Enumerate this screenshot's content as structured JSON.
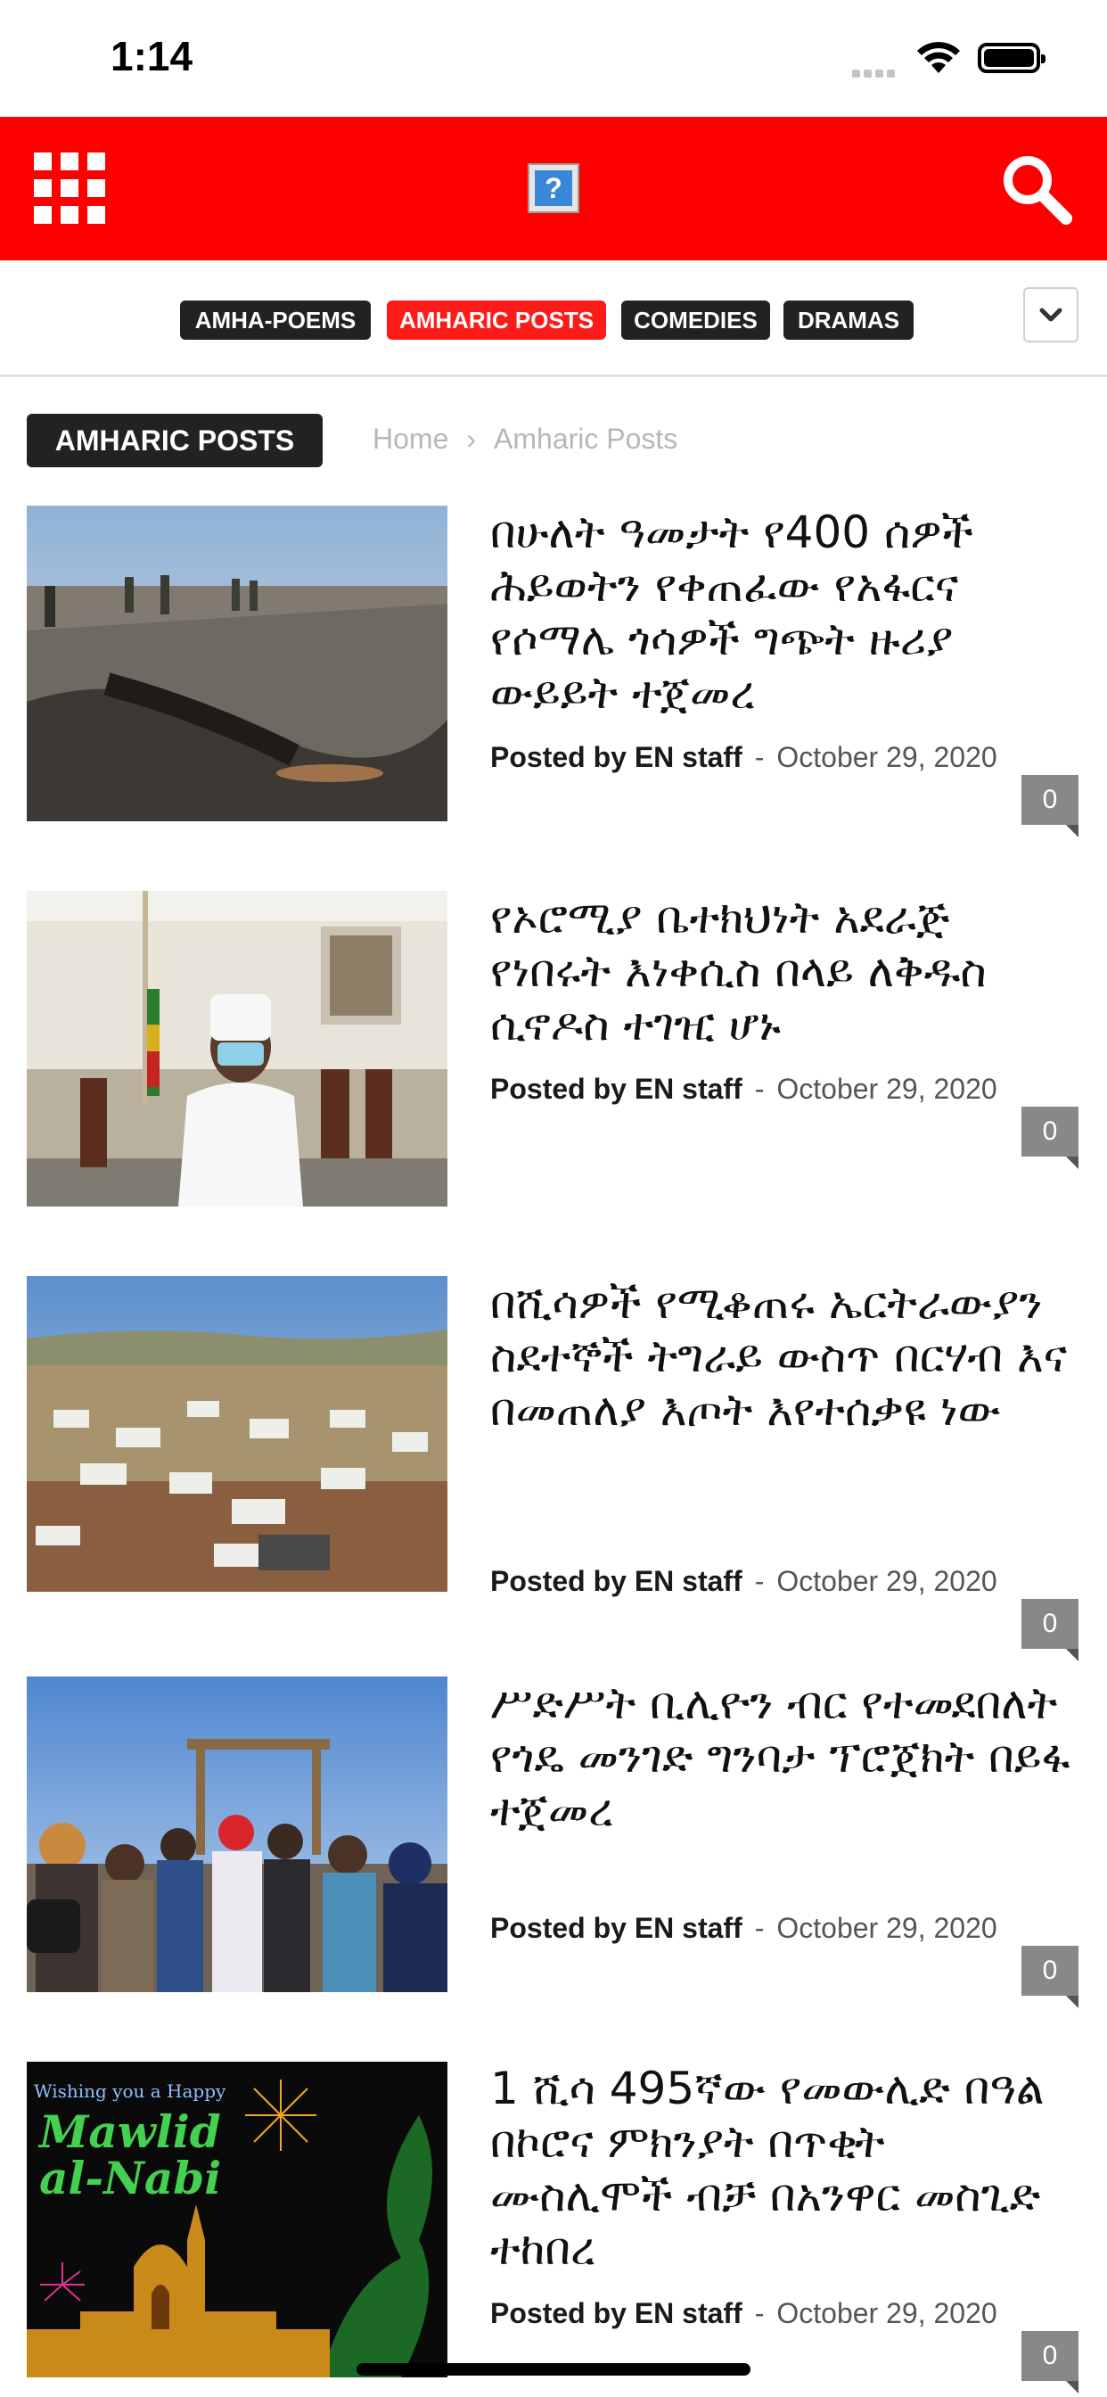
{
  "status_bar": {
    "time": "1:14"
  },
  "header": {
    "menu_icon": "grid-icon",
    "logo_icon": "question-mark-icon",
    "search_icon": "search-icon",
    "accent": "#ff0000"
  },
  "categories": [
    {
      "label": "AMHA-POEMS",
      "active": false
    },
    {
      "label": "AMHARIC POSTS",
      "active": true
    },
    {
      "label": "COMEDIES",
      "active": false
    },
    {
      "label": "DRAMAS",
      "active": false
    }
  ],
  "section": {
    "title": "AMHARIC POSTS"
  },
  "breadcrumb": {
    "home": "Home",
    "separator": "›",
    "current": "Amharic Posts"
  },
  "posts": [
    {
      "title": "በሁለት ዓመታት የ400 ሰዎች ሕይወትን የቀጠፈው የአፋርና የሶማሌ ጎሳዎች ግጭት ዙሪያ ውይይት ተጀመረ",
      "by": "Posted by EN staff",
      "dash": "-",
      "date": "October 29, 2020",
      "comments": "0"
    },
    {
      "title": "የኦሮሚያ ቤተክህነት አደራጅ የነበሩት እነቀሲስ በላይ ለቅዱስ ሲኖዶስ ተገዢ ሆኑ",
      "by": "Posted by EN staff",
      "dash": "-",
      "date": "October 29, 2020",
      "comments": "0"
    },
    {
      "title": "በሺሳዎች የሚቆጠሩ ኤርትራውያን ስደተኞች ትግራይ ውስጥ በርሃብ እና በመጠለያ እጦት እየተሰቃዩ ነው",
      "by": "Posted by EN staff",
      "dash": "-",
      "date": "October 29, 2020",
      "comments": "0"
    },
    {
      "title": "ሥድሥት ቢሊዮን ብር የተመደበለት የጎዴ መንገድ ግንባታ ፕሮጀክት በይፋ ተጀመረ",
      "by": "Posted by EN staff",
      "dash": "-",
      "date": "October 29, 2020",
      "comments": "0"
    },
    {
      "title": "1 ሺሳ 495ኛው የመውሊድ በዓል በኮሮና ምክንያት በጥቂት ሙስሊሞች ብቻ በአንዋር መስጊድ ተከበረ",
      "by": "Posted by EN staff",
      "dash": "-",
      "date": "October 29, 2020",
      "comments": "0",
      "image_text": {
        "line1": "Wishing you a Happy",
        "line2": "Mawlid",
        "line3": "al-Nabi"
      }
    }
  ]
}
